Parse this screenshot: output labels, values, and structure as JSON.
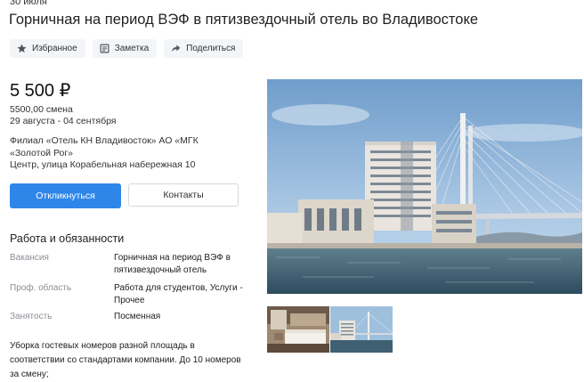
{
  "date": "30 июля",
  "title": "Горничная на период ВЭФ в пятизвездочный отель во Владивостоке",
  "actions": {
    "favorite": "Избранное",
    "note": "Заметка",
    "share": "Поделиться"
  },
  "price": "5 500 ₽",
  "rate": "5500,00 смена",
  "period": "29 августа - 04 сентября",
  "employer": "Филиал «Отель КН Владивосток» АО «МГК «Золотой Рог»",
  "address": "Центр, улица Корабельная набережная 10",
  "buttons": {
    "respond": "Откликнуться",
    "contacts": "Контакты"
  },
  "duties": {
    "heading": "Работа и обязанности",
    "rows": [
      {
        "label": "Вакансия",
        "value": "Горничная на период ВЭФ в пятизвездочный отель"
      },
      {
        "label": "Проф. область",
        "value": "Работа для студентов, Услуги - Прочее"
      },
      {
        "label": "Занятость",
        "value": "Посменная"
      }
    ]
  },
  "description": "Уборка гостевых номеров разной площадь в соответствии со стандартами компании. До 10 номеров за смену;",
  "icons": {
    "favorite": "star-icon",
    "note": "note-icon",
    "share": "share-arrow-icon"
  },
  "colors": {
    "primary": "#2f86e9",
    "action_bg": "#f3f5f8",
    "label_gray": "#8b8f96"
  }
}
